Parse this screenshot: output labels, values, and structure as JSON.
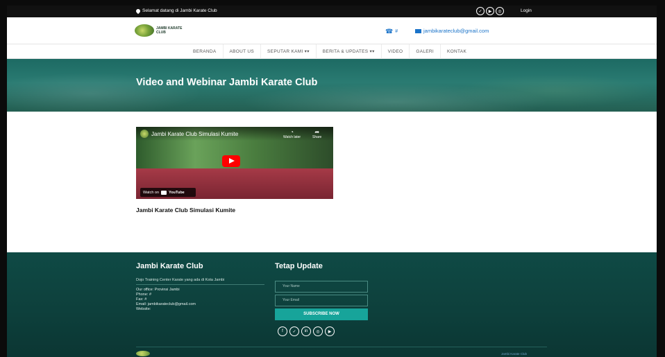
{
  "topbar": {
    "welcome": "Selamat datang di Jambi Karate Club",
    "socials": [
      "twitter-icon",
      "youtube-icon",
      "instagram-icon"
    ],
    "login": "Login"
  },
  "header": {
    "logo_line1": "JAMBI KARATE",
    "logo_line2": "CLUB",
    "phone": "#",
    "email": "jambikarateclub@gmail.com"
  },
  "nav": {
    "items": [
      "BERANDA",
      "ABOUT US",
      "SEPUTAR KAMI ▾▾",
      "BERITA & UPDATES ▾▾",
      "VIDEO",
      "GALERI",
      "KONTAK"
    ]
  },
  "hero": {
    "title": "Video and Webinar Jambi Karate Club"
  },
  "video": {
    "title": "Jambi Karate Club Simulasi Kumite",
    "watch_later": "Watch later",
    "share": "Share",
    "watch_on": "Watch on",
    "youtube": "YouTube",
    "caption": "Jambi Karate Club Simulasi Kumite"
  },
  "footer": {
    "club_title": "Jambi Karate Club",
    "club_desc": "Dojo Training Center Karate yang ada di Kota Jambi",
    "office": "Our office: Provinsi Jambi",
    "phone": "Phone: #",
    "fax": "Fax: #",
    "email": "Email: jambikarateclub@gmail.com",
    "website": "Website:",
    "update_title": "Tetap Update",
    "name_placeholder": "Your Name",
    "email_placeholder": "Your Email",
    "subscribe": "SUBSCRIBE NOW",
    "socials": [
      "facebook-icon",
      "twitter-icon",
      "linkedin-icon",
      "instagram-icon",
      "youtube-icon"
    ],
    "copyright": "Jambi Karate Club"
  },
  "colors": {
    "accent": "#1a73c9",
    "footer_bg": "#0f4a45",
    "subscribe_bg": "#17a49a",
    "topbar_bg": "#111111"
  }
}
